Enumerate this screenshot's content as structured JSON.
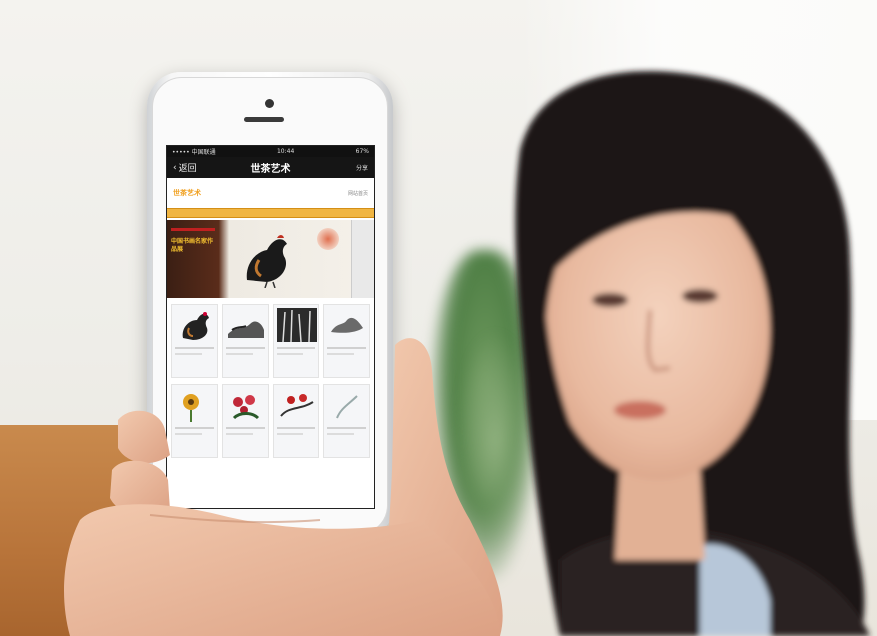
{
  "photo": {
    "subject": "woman-holding-smartphone",
    "colors": {
      "wall": "#efeeea",
      "hair": "#1a1514",
      "skin": "#eabfa6",
      "phone_body": "#f2f2f2",
      "accent_menu": "#f0b542",
      "table": "#b8743a"
    }
  },
  "phone_screen": {
    "status": {
      "left": "••••• 中国联通 ",
      "center": "10:44",
      "right": "67%"
    },
    "nav": {
      "back_label": "返回",
      "title": "世茶艺术",
      "right_label": "分享"
    },
    "site": {
      "logo_text": "世茶艺术",
      "header_link": "网站首页"
    },
    "banner": {
      "text": "中国书画名家作品展"
    }
  }
}
